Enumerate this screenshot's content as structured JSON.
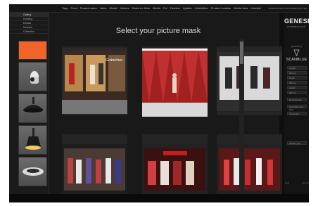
{
  "menu": [
    "Tags",
    "Front",
    "Passed sales",
    "Value",
    "Model",
    "Visitors",
    "Dates en fiche",
    "Media",
    "Foi",
    "Fashion",
    "Update",
    "Celebrities",
    "Product location",
    "Media view",
    "Lifestyle"
  ],
  "status_text": "ENREGISTRER  SUPPRIMER  QUITTER",
  "categories": [
    "Gallery",
    "Housing",
    "Details",
    "Nearest",
    "Collection"
  ],
  "title": "Select your picture mask",
  "brand": {
    "name": "GENESIS",
    "subtitle": "MANNEQUINS",
    "powered": "powered by",
    "partner": "SCANBLUE"
  },
  "fields": [
    "Length",
    "000 cm",
    "Depth",
    "000 cm",
    "Height",
    "000 cm",
    "Pedestal size",
    "Select/Remove base",
    "Orientation",
    "Display type"
  ],
  "footer": {
    "left": "Help",
    "right": "Lomme"
  },
  "tile_labels": [
    "Gränicher"
  ],
  "colors": {
    "accent": "#f0642a",
    "background": "#191919"
  }
}
